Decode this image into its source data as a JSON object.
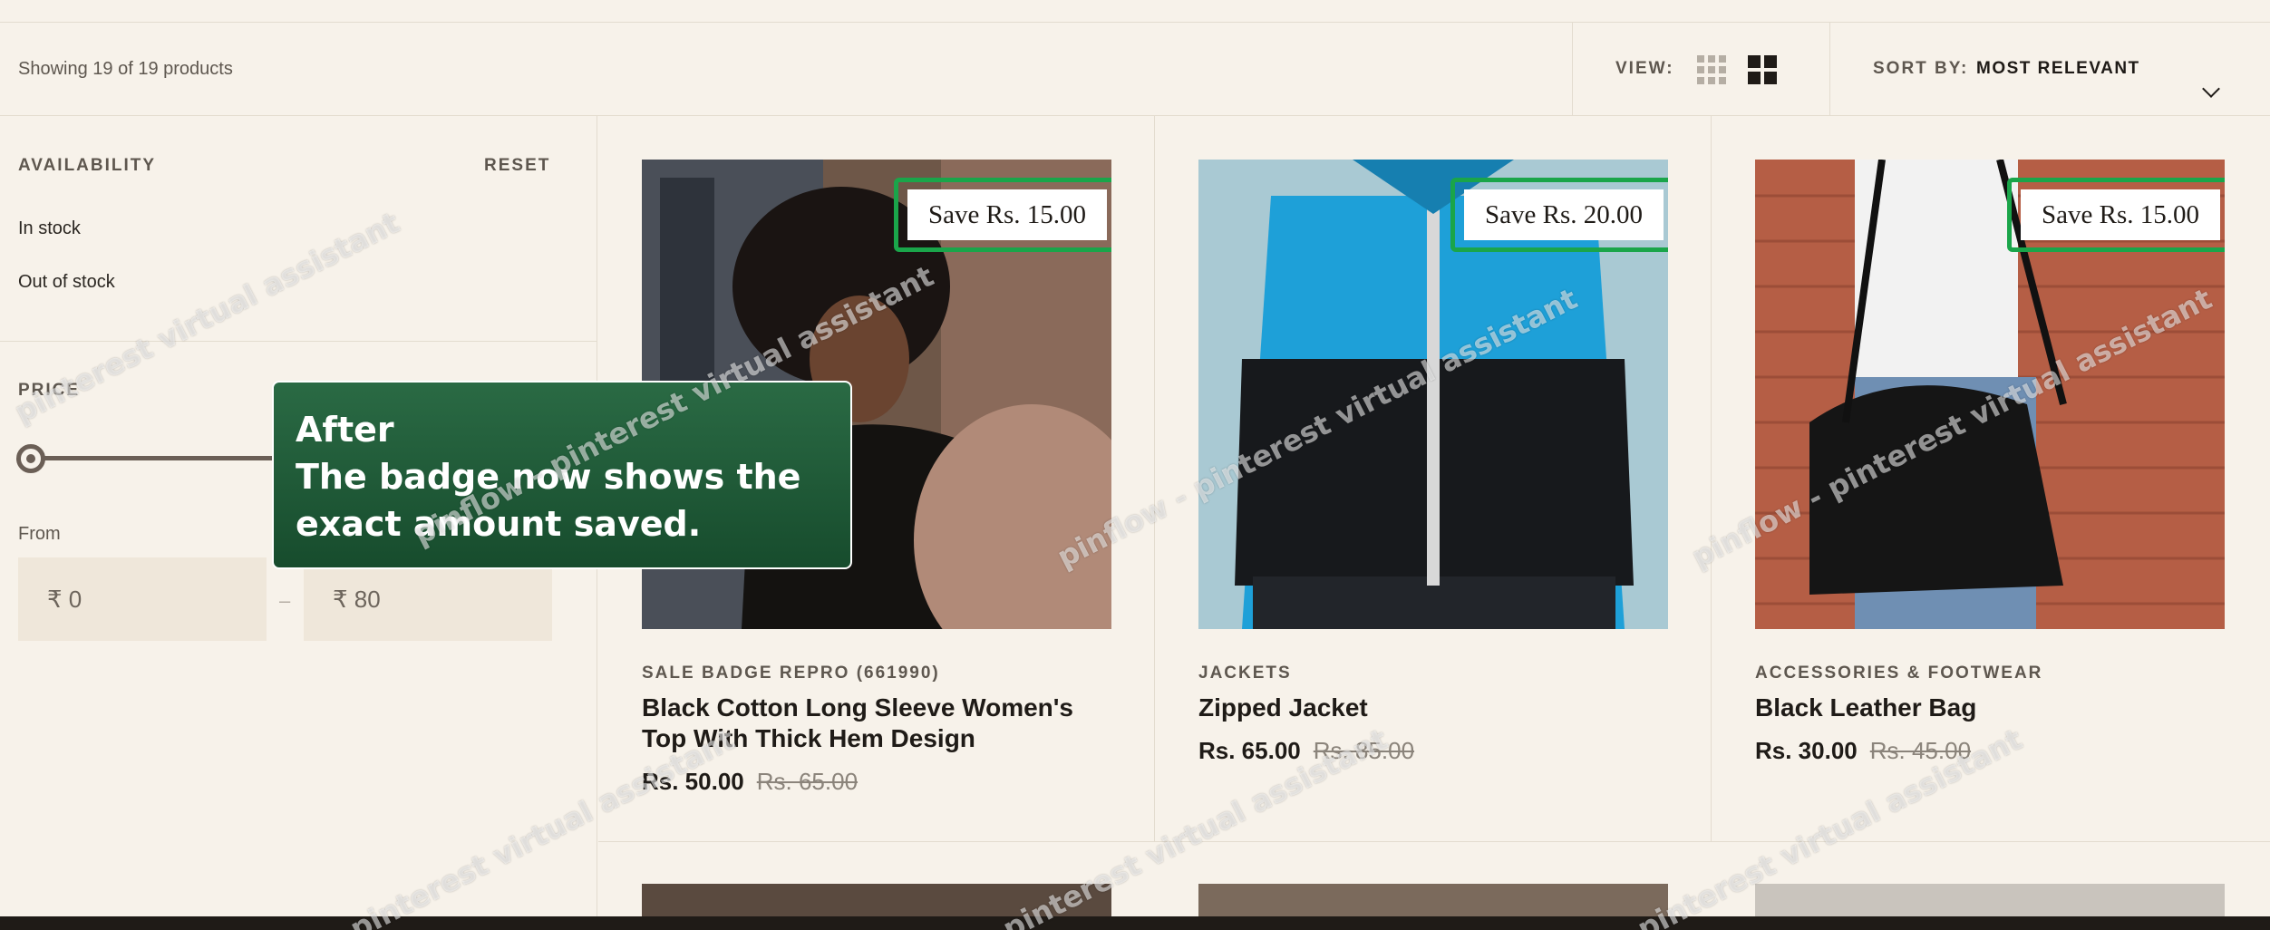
{
  "toolbar": {
    "showing_text": "Showing 19 of 19 products",
    "view_label": "VIEW:",
    "sort_label": "SORT BY:",
    "sort_value": "MOST RELEVANT"
  },
  "filters": {
    "availability": {
      "title": "AVAILABILITY",
      "reset_label": "RESET",
      "options": [
        "In stock",
        "Out of stock"
      ]
    },
    "price": {
      "title": "PRICE",
      "from_label": "From",
      "min_value": "₹ 0",
      "max_value": "₹ 80",
      "separator": "–"
    }
  },
  "annotation": {
    "heading": "After",
    "body": "The badge now shows the exact amount saved."
  },
  "products": [
    {
      "badge": "Save Rs. 15.00",
      "category": "SALE BADGE REPRO (661990)",
      "title": "Black Cotton Long Sleeve Women's Top With Thick Hem Design",
      "price": "Rs. 50.00",
      "compare_price": "Rs. 65.00"
    },
    {
      "badge": "Save Rs. 20.00",
      "category": "JACKETS",
      "title": "Zipped Jacket",
      "price": "Rs. 65.00",
      "compare_price": "Rs. 85.00"
    },
    {
      "badge": "Save Rs. 15.00",
      "category": "ACCESSORIES & FOOTWEAR",
      "title": "Black Leather Bag",
      "price": "Rs. 30.00",
      "compare_price": "Rs. 45.00"
    }
  ],
  "watermarks": [
    "pinterest virtual assistant",
    "pinflow - pinterest virtual assistant",
    "pinflow - pinterest virtual assistant",
    "pinflow - pinterest virtual assistant",
    "pinterest virtual assistant",
    "pinterest virtual assistant",
    "pinterest virtual assistant"
  ],
  "colors": {
    "page_bg": "#f7f2ea",
    "badge_outline": "#1aa54a",
    "annotation_bg": "#1f5a35"
  }
}
